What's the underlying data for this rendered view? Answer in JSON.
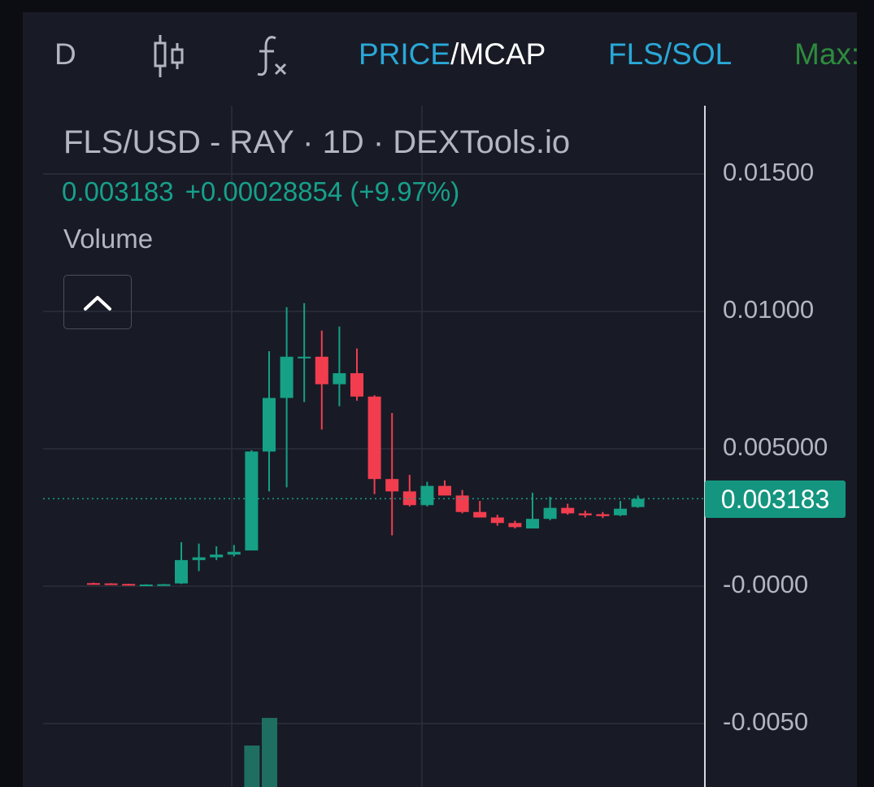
{
  "toolbar": {
    "interval": "D",
    "candle_icon": "candlestick-icon",
    "indicator_icon": "function-fx-icon",
    "price_label": "PRICE",
    "separator": "/",
    "mcap_label": "MCAP",
    "pair_label": "FLS/SOL",
    "max_label": "Max:"
  },
  "legend": {
    "title": "FLS/USD - RAY · 1D · DEXTools.io",
    "last_price": "0.003183",
    "change": "+0.00028854 (+9.97%)",
    "volume_label": "Volume",
    "collapse_icon": "chevron-up-icon"
  },
  "colors": {
    "up": "#16a085",
    "down": "#f23d4f",
    "background": "#181b26",
    "grid": "#2b2f3b",
    "text": "#b3b6bf",
    "accent_cyan": "#2aa8d8",
    "max_green": "#2e8b3d",
    "volume": "#1e6e62"
  },
  "chart_data": {
    "type": "candlestick",
    "title": "FLS/USD - RAY · 1D · DEXTools.io",
    "y_ticks": [
      "0.01500",
      "0.01000",
      "0.005000",
      "-0.0000",
      "-0.0050"
    ],
    "y_tick_values": [
      0.015,
      0.01,
      0.005,
      0,
      -0.005
    ],
    "ylim": [
      -0.0058,
      0.0165
    ],
    "last_price_label": "0.003183",
    "last_price_value": 0.003183,
    "grid": true,
    "candles": [
      {
        "o": 0.00011,
        "h": 0.00013,
        "l": 0.0001,
        "c": 0.0001
      },
      {
        "o": 0.0001,
        "h": 0.00011,
        "l": 8e-05,
        "c": 8e-05
      },
      {
        "o": 8e-05,
        "h": 9e-05,
        "l": 6e-05,
        "c": 6e-05
      },
      {
        "o": 5e-05,
        "h": 7e-05,
        "l": 5e-05,
        "c": 6e-05
      },
      {
        "o": 6e-05,
        "h": 8e-05,
        "l": 5e-05,
        "c": 7e-05
      },
      {
        "o": 0.0001,
        "h": 0.0016,
        "l": 8e-05,
        "c": 0.00095
      },
      {
        "o": 0.00095,
        "h": 0.00155,
        "l": 0.00055,
        "c": 0.00105
      },
      {
        "o": 0.00105,
        "h": 0.00145,
        "l": 0.00095,
        "c": 0.00115
      },
      {
        "o": 0.00115,
        "h": 0.0015,
        "l": 0.00108,
        "c": 0.00125
      },
      {
        "o": 0.0013,
        "h": 0.00495,
        "l": 0.0013,
        "c": 0.0049
      },
      {
        "o": 0.0049,
        "h": 0.00855,
        "l": 0.00345,
        "c": 0.00685
      },
      {
        "o": 0.00685,
        "h": 0.01015,
        "l": 0.0036,
        "c": 0.00835
      },
      {
        "o": 0.00835,
        "h": 0.0103,
        "l": 0.0067,
        "c": 0.00835
      },
      {
        "o": 0.00835,
        "h": 0.0093,
        "l": 0.0057,
        "c": 0.00735
      },
      {
        "o": 0.00735,
        "h": 0.00945,
        "l": 0.00655,
        "c": 0.00775
      },
      {
        "o": 0.00775,
        "h": 0.00865,
        "l": 0.00675,
        "c": 0.0069
      },
      {
        "o": 0.0069,
        "h": 0.00695,
        "l": 0.00335,
        "c": 0.0039
      },
      {
        "o": 0.0039,
        "h": 0.0063,
        "l": 0.00185,
        "c": 0.00345
      },
      {
        "o": 0.00345,
        "h": 0.00405,
        "l": 0.0029,
        "c": 0.00295
      },
      {
        "o": 0.00295,
        "h": 0.0038,
        "l": 0.0029,
        "c": 0.00365
      },
      {
        "o": 0.00365,
        "h": 0.00385,
        "l": 0.0033,
        "c": 0.0033
      },
      {
        "o": 0.0033,
        "h": 0.0035,
        "l": 0.00265,
        "c": 0.0027
      },
      {
        "o": 0.0027,
        "h": 0.0031,
        "l": 0.0025,
        "c": 0.0025
      },
      {
        "o": 0.0025,
        "h": 0.0026,
        "l": 0.0022,
        "c": 0.0023
      },
      {
        "o": 0.0023,
        "h": 0.00238,
        "l": 0.0021,
        "c": 0.00215
      },
      {
        "o": 0.0021,
        "h": 0.0034,
        "l": 0.0021,
        "c": 0.00245
      },
      {
        "o": 0.00245,
        "h": 0.00325,
        "l": 0.0024,
        "c": 0.00285
      },
      {
        "o": 0.00285,
        "h": 0.003,
        "l": 0.0026,
        "c": 0.00265
      },
      {
        "o": 0.00265,
        "h": 0.00275,
        "l": 0.0025,
        "c": 0.00258
      },
      {
        "o": 0.00262,
        "h": 0.0027,
        "l": 0.00248,
        "c": 0.00255
      },
      {
        "o": 0.00258,
        "h": 0.0031,
        "l": 0.00255,
        "c": 0.00282
      },
      {
        "o": 0.00288,
        "h": 0.0033,
        "l": 0.00285,
        "c": 0.00318
      }
    ],
    "volume_visible": [
      {
        "candle_index": 9,
        "level": 0.6
      },
      {
        "candle_index": 10,
        "level": 1.0
      }
    ]
  }
}
